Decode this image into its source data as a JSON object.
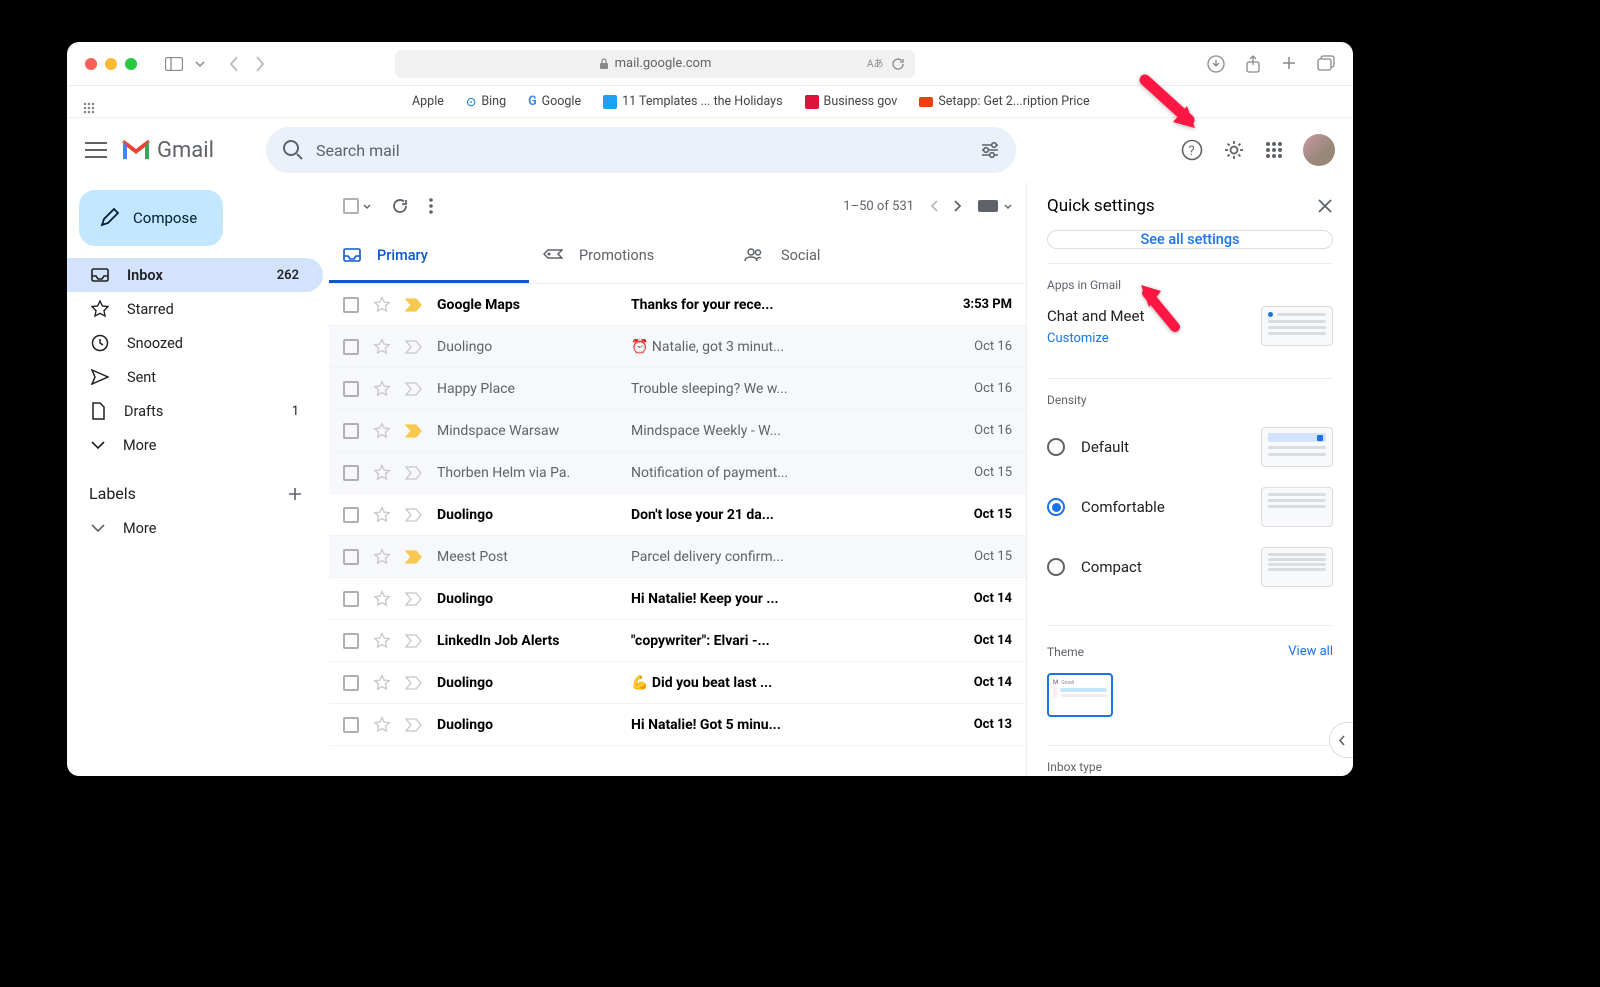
{
  "url": "mail.google.com",
  "bookmarks": [
    "Apple",
    "Bing",
    "Google",
    "11 Templates ... the Holidays",
    "Business gov",
    "Setapp: Get 2...ription Price"
  ],
  "app": "Gmail",
  "search_placeholder": "Search mail",
  "compose": "Compose",
  "nav": [
    {
      "icon": "inbox",
      "label": "Inbox",
      "count": "262",
      "active": true
    },
    {
      "icon": "star",
      "label": "Starred"
    },
    {
      "icon": "clock",
      "label": "Snoozed"
    },
    {
      "icon": "send",
      "label": "Sent"
    },
    {
      "icon": "file",
      "label": "Drafts",
      "count": "1"
    },
    {
      "icon": "chev",
      "label": "More"
    }
  ],
  "labels_title": "Labels",
  "labels_more": "More",
  "pagination": "1–50 of 531",
  "tabs": [
    {
      "label": "Primary",
      "active": true
    },
    {
      "label": "Promotions"
    },
    {
      "label": "Social"
    }
  ],
  "emails": [
    {
      "sender": "Google Maps",
      "subject": "Thanks for your rece...",
      "date": "3:53 PM",
      "unread": true,
      "important": true
    },
    {
      "sender": "Duolingo",
      "subject": "⏰ Natalie, got 3 minut...",
      "date": "Oct 16",
      "unread": false,
      "important": false
    },
    {
      "sender": "Happy Place",
      "subject": "Trouble sleeping? We w...",
      "date": "Oct 16",
      "unread": false,
      "important": false
    },
    {
      "sender": "Mindspace Warsaw",
      "subject": "Mindspace Weekly - W...",
      "date": "Oct 16",
      "unread": false,
      "important": true
    },
    {
      "sender": "Thorben Helm via Pa.",
      "subject": "Notification of payment...",
      "date": "Oct 15",
      "unread": false,
      "important": false
    },
    {
      "sender": "Duolingo",
      "subject": "Don't lose your 21 da...",
      "date": "Oct 15",
      "unread": true,
      "important": false
    },
    {
      "sender": "Meest Post",
      "subject": "Parcel delivery confirm...",
      "date": "Oct 15",
      "unread": false,
      "important": true
    },
    {
      "sender": "Duolingo",
      "subject": "Hi Natalie! Keep your ...",
      "date": "Oct 14",
      "unread": true,
      "important": false
    },
    {
      "sender": "LinkedIn Job Alerts",
      "subject": "\"copywriter\": Elvari -...",
      "date": "Oct 14",
      "unread": true,
      "important": false
    },
    {
      "sender": "Duolingo",
      "subject": "💪 Did you beat last ...",
      "date": "Oct 14",
      "unread": true,
      "important": false
    },
    {
      "sender": "Duolingo",
      "subject": "Hi Natalie! Got 5 minu...",
      "date": "Oct 13",
      "unread": true,
      "important": false
    }
  ],
  "qs": {
    "title": "Quick settings",
    "see_all": "See all settings",
    "apps_title": "Apps in Gmail",
    "apps_label": "Chat and Meet",
    "customize": "Customize",
    "density_title": "Density",
    "density": [
      "Default",
      "Comfortable",
      "Compact"
    ],
    "density_selected": 1,
    "theme_title": "Theme",
    "view_all": "View all",
    "inbox_type": "Inbox type"
  }
}
